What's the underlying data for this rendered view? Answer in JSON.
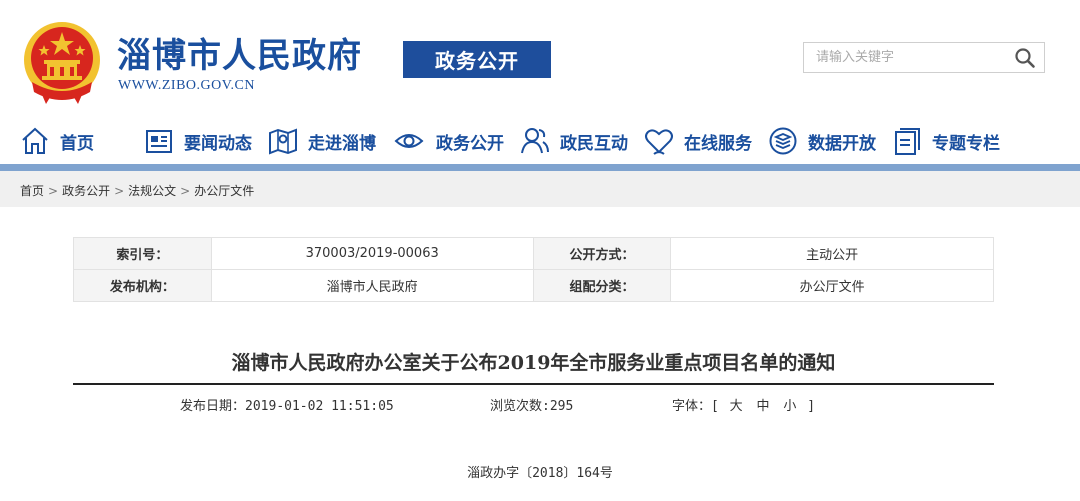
{
  "header": {
    "site_title": "淄博市人民政府",
    "site_url": "WWW.ZIBO.GOV.CN",
    "section_badge": "政务公开",
    "search_placeholder": "请输入关键字"
  },
  "nav": {
    "items": [
      {
        "label": "首页",
        "icon": "home-icon"
      },
      {
        "label": "要闻动态",
        "icon": "news-icon"
      },
      {
        "label": "走进淄博",
        "icon": "map-icon"
      },
      {
        "label": "政务公开",
        "icon": "eye-icon"
      },
      {
        "label": "政民互动",
        "icon": "people-icon"
      },
      {
        "label": "在线服务",
        "icon": "heart-icon"
      },
      {
        "label": "数据开放",
        "icon": "data-icon"
      },
      {
        "label": "专题专栏",
        "icon": "folder-icon"
      }
    ]
  },
  "breadcrumb": [
    "首页",
    "政务公开",
    "法规公文",
    "办公厅文件"
  ],
  "breadcrumb_separator": ">",
  "info": {
    "index_label": "索引号：",
    "index_value": "370003/2019-00063",
    "open_mode_label": "公开方式：",
    "open_mode_value": "主动公开",
    "publisher_label": "发布机构：",
    "publisher_value": "淄博市人民政府",
    "category_label": "组配分类：",
    "category_value": "办公厅文件"
  },
  "article": {
    "title": "淄博市人民政府办公室关于公布2019年全市服务业重点项目名单的通知",
    "publish_date_label": "发布日期：",
    "publish_date": "2019-01-02 11:51:05",
    "views_label": "浏览次数:",
    "views": "295",
    "font_label": "字体：",
    "font_open": "[",
    "font_large": "大",
    "font_medium": "中",
    "font_small": "小",
    "font_close": "]",
    "doc_number": "淄政办字〔2018〕164号"
  },
  "colors": {
    "brand_blue": "#1a4f9e",
    "nav_rule": "#7fa3cf",
    "emblem_red": "#d7261e",
    "emblem_gold": "#f2c230"
  }
}
